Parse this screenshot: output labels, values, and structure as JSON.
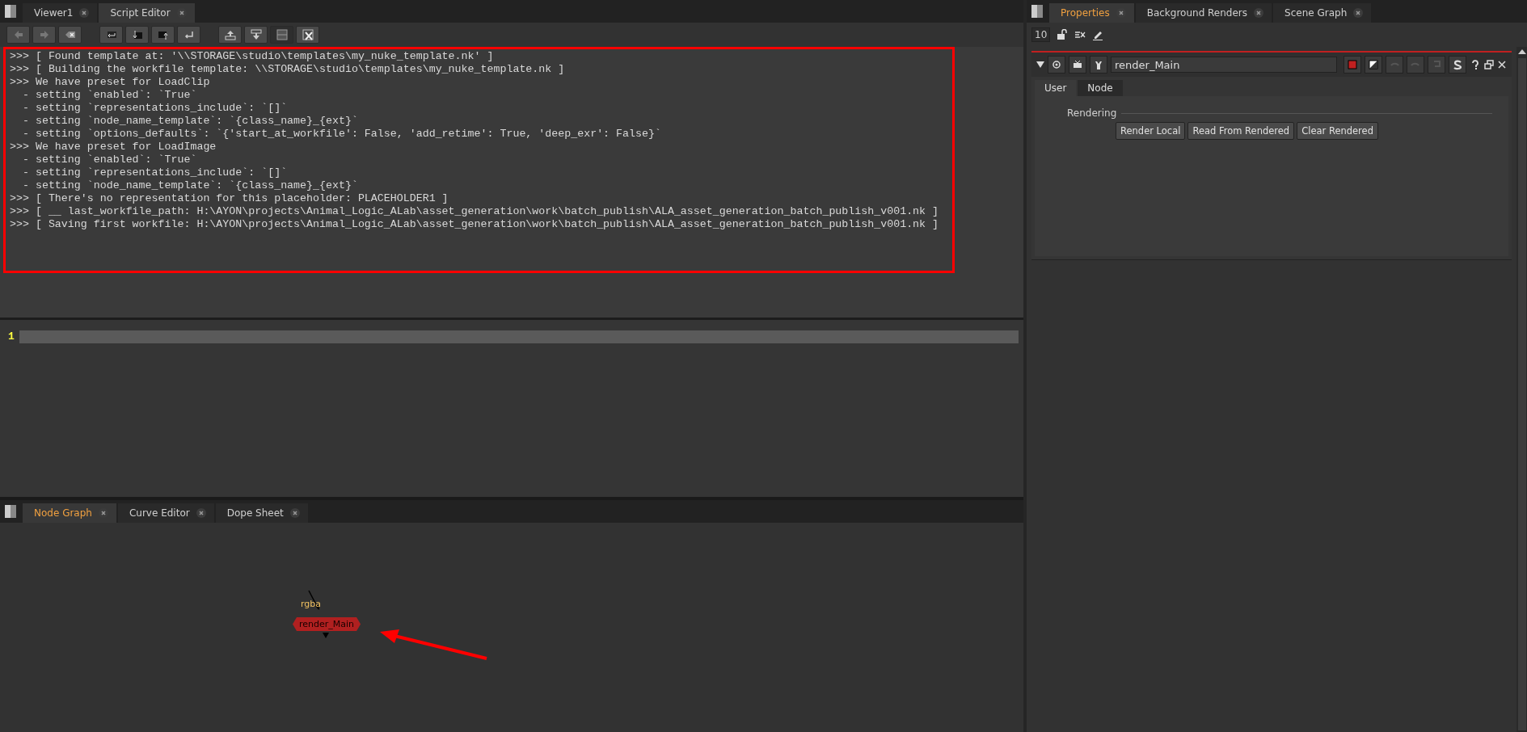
{
  "script_editor": {
    "tabs": [
      {
        "label": "Viewer1",
        "selected": false
      },
      {
        "label": "Script Editor",
        "selected": true
      }
    ],
    "toolbar": [
      {
        "on": false
      },
      {
        "on": false
      },
      {
        "on": false
      },
      {
        "on": false
      },
      {
        "on": false
      },
      {
        "on": false
      },
      {
        "on": false
      },
      {
        "on": false
      },
      {
        "on": false
      },
      {
        "on": true
      },
      {
        "on": false
      }
    ],
    "output_lines": [
      ">>> [ Found template at: '\\\\STORAGE\\studio\\templates\\my_nuke_template.nk' ]",
      ">>> [ Building the workfile template: \\\\STORAGE\\studio\\templates\\my_nuke_template.nk ]",
      ">>> We have preset for LoadClip",
      "  - setting `enabled`: `True`",
      "  - setting `representations_include`: `[]`",
      "  - setting `node_name_template`: `{class_name}_{ext}`",
      "  - setting `options_defaults`: `{'start_at_workfile': False, 'add_retime': True, 'deep_exr': False}`",
      ">>> We have preset for LoadImage",
      "  - setting `enabled`: `True`",
      "  - setting `representations_include`: `[]`",
      "  - setting `node_name_template`: `{class_name}_{ext}`",
      ">>> [ There's no representation for this placeholder: PLACEHOLDER1 ]",
      ">>> [ __ last_workfile_path: H:\\AYON\\projects\\Animal_Logic_ALab\\asset_generation\\work\\batch_publish\\ALA_asset_generation_batch_publish_v001.nk ]",
      ">>> [ Saving first workfile: H:\\AYON\\projects\\Animal_Logic_ALab\\asset_generation\\work\\batch_publish\\ALA_asset_generation_batch_publish_v001.nk ]"
    ],
    "input_line_numbers": [
      "1"
    ]
  },
  "node_graph": {
    "tabs": [
      {
        "label": "Node Graph",
        "selected": true
      },
      {
        "label": "Curve Editor",
        "selected": false
      },
      {
        "label": "Dope Sheet",
        "selected": false
      }
    ],
    "nodes": [
      {
        "label": "render_Main",
        "input_label": "rgba"
      }
    ]
  },
  "properties": {
    "tabs": [
      {
        "label": "Properties",
        "selected": true
      },
      {
        "label": "Background Renders",
        "selected": false
      },
      {
        "label": "Scene Graph",
        "selected": false
      }
    ],
    "max_panels": "10",
    "node_panel": {
      "name": "render_Main",
      "tabs": [
        {
          "label": "User",
          "selected": true
        },
        {
          "label": "Node",
          "selected": false
        }
      ],
      "section": "Rendering",
      "buttons": [
        "Render Local",
        "Read From Rendered",
        "Clear Rendered"
      ]
    }
  }
}
